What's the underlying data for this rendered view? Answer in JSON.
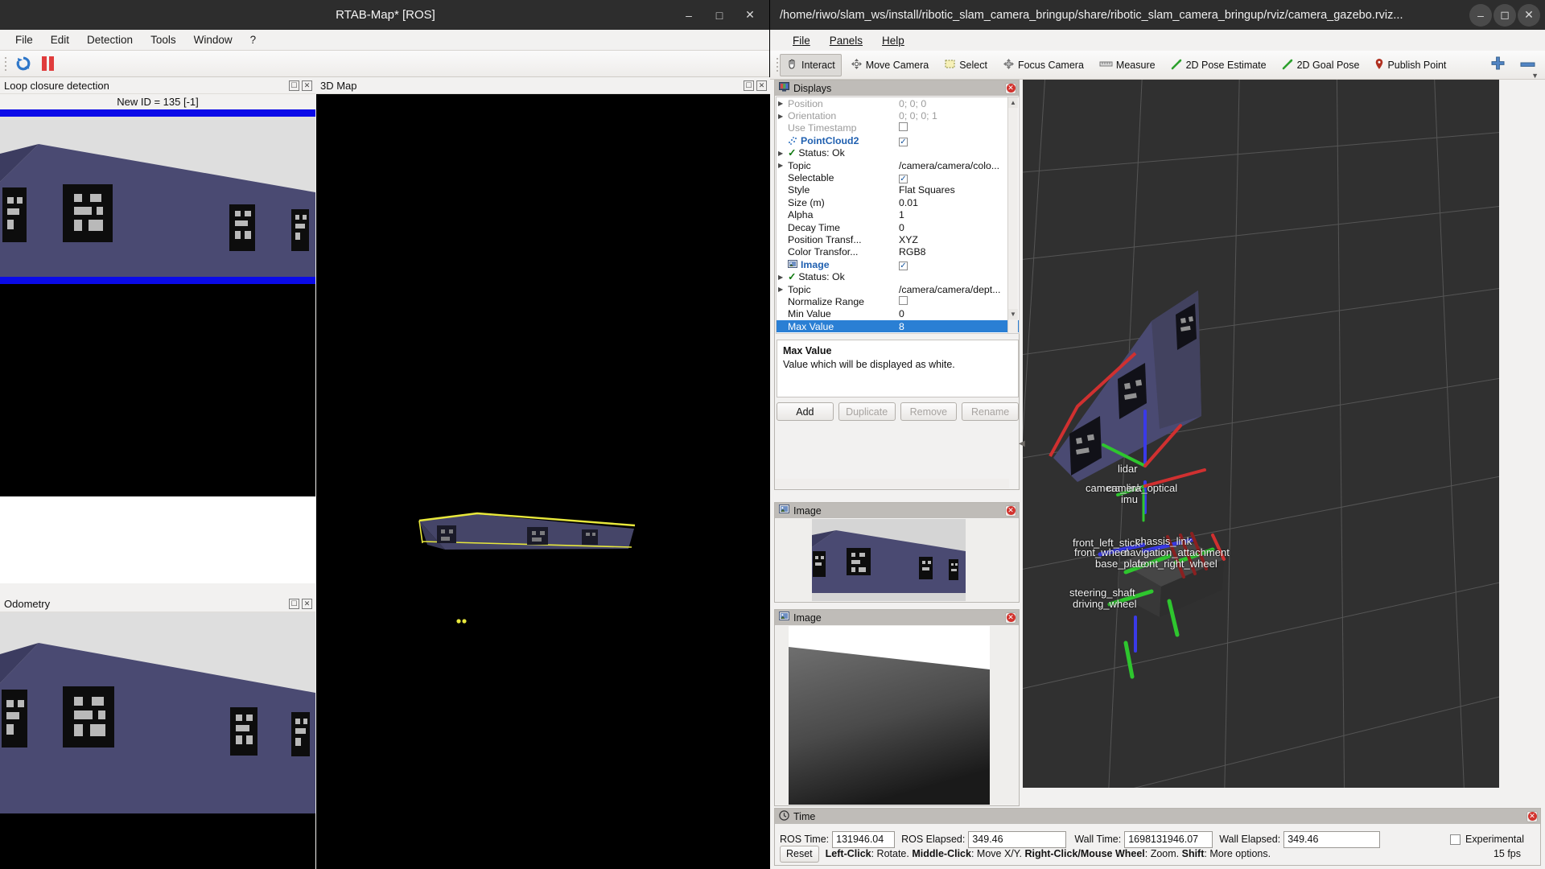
{
  "rtabmap": {
    "title": "RTAB-Map* [ROS]",
    "window_buttons": [
      "minimize",
      "maximize",
      "close"
    ],
    "menu": [
      "File",
      "Edit",
      "Detection",
      "Tools",
      "Window",
      "?"
    ],
    "toolbar_icons": [
      "refresh-icon",
      "pause-icon"
    ],
    "panels": {
      "loop_closure": {
        "title": "Loop closure detection",
        "new_id": "New ID = 135 [-1]"
      },
      "odometry": {
        "title": "Odometry"
      },
      "map3d": {
        "title": "3D Map"
      }
    }
  },
  "rviz": {
    "title": "/home/riwo/slam_ws/install/ribotic_slam_camera_bringup/share/ribotic_slam_camera_bringup/rviz/camera_gazebo.rviz...",
    "menu": [
      "File",
      "Panels",
      "Help"
    ],
    "toolbar": [
      {
        "label": "Interact",
        "icon": "hand-cursor-icon",
        "active": true
      },
      {
        "label": "Move Camera",
        "icon": "move-camera-icon",
        "active": false
      },
      {
        "label": "Select",
        "icon": "select-box-icon",
        "active": false
      },
      {
        "label": "Focus Camera",
        "icon": "focus-camera-icon",
        "active": false
      },
      {
        "label": "Measure",
        "icon": "ruler-icon",
        "active": false
      },
      {
        "label": "2D Pose Estimate",
        "icon": "pose-arrow-icon",
        "active": false
      },
      {
        "label": "2D Goal Pose",
        "icon": "goal-arrow-icon",
        "active": false
      },
      {
        "label": "Publish Point",
        "icon": "map-pin-icon",
        "active": false
      }
    ],
    "toolbar_right": [
      {
        "icon": "plus-icon"
      },
      {
        "icon": "minus-icon"
      },
      {
        "icon": "chevron-down-icon"
      }
    ],
    "displays": {
      "title": "Displays",
      "icon": "displays-monitor-icon",
      "rows": [
        {
          "name": "Position",
          "value": "0; 0; 0",
          "kind": "dim",
          "expand": true
        },
        {
          "name": "Orientation",
          "value": "0; 0; 0; 1",
          "kind": "dim",
          "expand": true
        },
        {
          "name": "Use Timestamp",
          "value": "",
          "kind": "dim",
          "checkbox": "unchecked"
        },
        {
          "name": "PointCloud2",
          "value": "",
          "kind": "header",
          "icon": "pointcloud-icon",
          "checkbox": "checked"
        },
        {
          "name": "Status: Ok",
          "value": "",
          "kind": "status",
          "expand": true
        },
        {
          "name": "Topic",
          "value": "/camera/camera/colo...",
          "kind": "normal",
          "expand": true
        },
        {
          "name": "Selectable",
          "value": "",
          "kind": "normal",
          "checkbox": "checked"
        },
        {
          "name": "Style",
          "value": "Flat Squares",
          "kind": "normal"
        },
        {
          "name": "Size (m)",
          "value": "0.01",
          "kind": "normal"
        },
        {
          "name": "Alpha",
          "value": "1",
          "kind": "normal"
        },
        {
          "name": "Decay Time",
          "value": "0",
          "kind": "normal"
        },
        {
          "name": "Position Transf...",
          "value": "XYZ",
          "kind": "normal"
        },
        {
          "name": "Color Transfor...",
          "value": "RGB8",
          "kind": "normal"
        },
        {
          "name": "Image",
          "value": "",
          "kind": "header",
          "icon": "image-icon",
          "checkbox": "checked"
        },
        {
          "name": "Status: Ok",
          "value": "",
          "kind": "status",
          "expand": true
        },
        {
          "name": "Topic",
          "value": "/camera/camera/dept...",
          "kind": "normal",
          "expand": true
        },
        {
          "name": "Normalize Range",
          "value": "",
          "kind": "normal",
          "checkbox": "unchecked"
        },
        {
          "name": "Min Value",
          "value": "0",
          "kind": "normal"
        },
        {
          "name": "Max Value",
          "value": "8",
          "kind": "normal",
          "selected": true
        }
      ],
      "description": {
        "title": "Max Value",
        "text": "Value which will be displayed as white."
      },
      "buttons": [
        {
          "label": "Add",
          "enabled": true
        },
        {
          "label": "Duplicate",
          "enabled": false
        },
        {
          "label": "Remove",
          "enabled": false
        },
        {
          "label": "Rename",
          "enabled": false
        }
      ]
    },
    "image_panels": [
      {
        "title": "Image",
        "icon": "image-icon"
      },
      {
        "title": "Image",
        "icon": "image-icon"
      }
    ],
    "frames": [
      "lidar",
      "camera_link",
      "camera_optical",
      "imu",
      "front_left_stick",
      "chassis_link",
      "front_wheel",
      "navigation_attachment",
      "front_right_wheel",
      "base_plate",
      "steering_shaft",
      "driving_wheel"
    ],
    "time": {
      "title": "Time",
      "icon": "clock-icon",
      "fields": [
        {
          "label": "ROS Time:",
          "value": "131946.04"
        },
        {
          "label": "ROS Elapsed:",
          "value": "349.46"
        },
        {
          "label": "Wall Time:",
          "value": "1698131946.07"
        },
        {
          "label": "Wall Elapsed:",
          "value": "349.46"
        }
      ],
      "experimental_label": "Experimental",
      "experimental_checked": false
    },
    "status": {
      "reset_label": "Reset",
      "hint_parts": [
        {
          "text": "Left-Click",
          "bold": true
        },
        {
          "text": ": Rotate. ",
          "bold": false
        },
        {
          "text": "Middle-Click",
          "bold": true
        },
        {
          "text": ": Move X/Y. ",
          "bold": false
        },
        {
          "text": "Right-Click/Mouse Wheel",
          "bold": true
        },
        {
          "text": ": Zoom. ",
          "bold": false
        },
        {
          "text": "Shift",
          "bold": true
        },
        {
          "text": ": More options.",
          "bold": false
        }
      ],
      "fps": "15 fps"
    }
  },
  "colors": {
    "titlebar": "#2d2d2d",
    "panel_bg": "#f2f1f0",
    "selection": "#2a7fd4",
    "link_blue": "#2060b0",
    "status_green": "#127a12",
    "wall_purple": "#4a4a72",
    "marker_black": "#0d0d0d",
    "loop_blue": "#0a0ae8",
    "viewport_gray": "#303030",
    "close_red": "#d2322d"
  }
}
